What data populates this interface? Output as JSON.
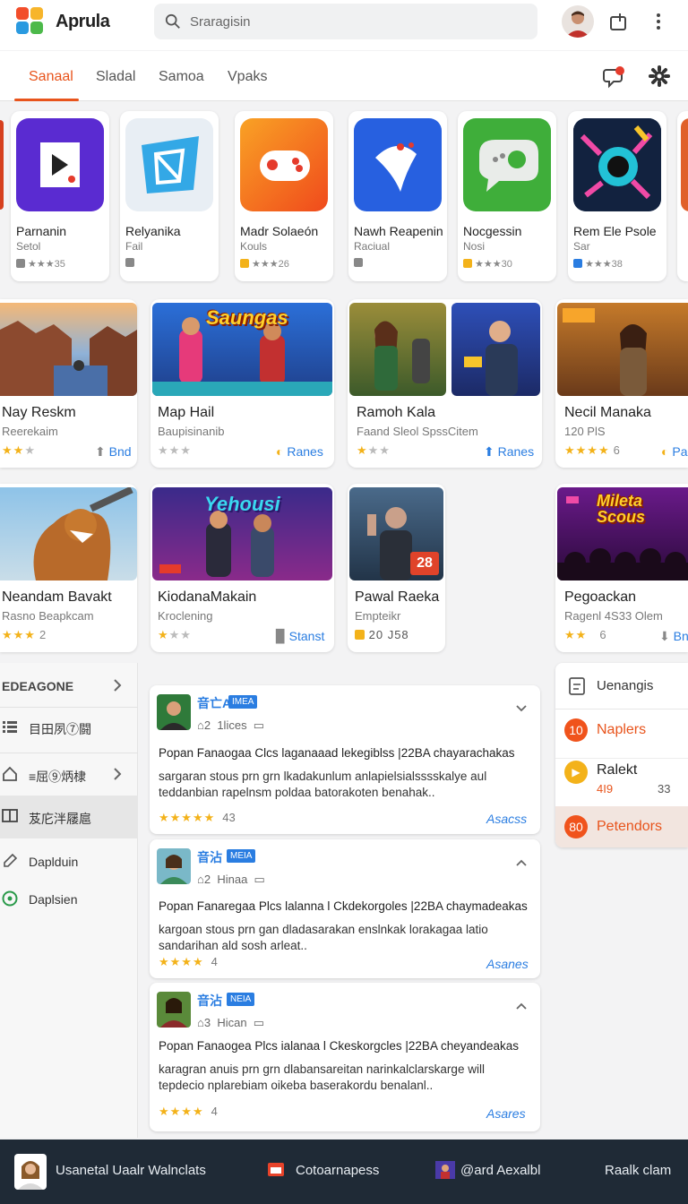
{
  "app": {
    "name": "Aprula"
  },
  "search": {
    "placeholder": "Sraragisin"
  },
  "tabs": [
    "Sanaal",
    "Sladal",
    "Samoa",
    "Vpaks"
  ],
  "apps": [
    {
      "name": "Parnanin",
      "sub": "Setol",
      "rating": "★★★35",
      "icon_color": "#5a2bd1"
    },
    {
      "name": "Relyanika",
      "sub": "Fail",
      "rating": "",
      "icon_color": "#33a8e6"
    },
    {
      "name": "Madr Solaeón",
      "sub": "Kouls",
      "rating": "★★★26",
      "icon_color": "#f26a20"
    },
    {
      "name": "Nawh Reapenin",
      "sub": "Raciual",
      "rating": "",
      "icon_color": "#2760e0"
    },
    {
      "name": "Nocgessin",
      "sub": "Nosi",
      "rating": "★★★30",
      "icon_color": "#3fae3a"
    },
    {
      "name": "Rem Ele Psole",
      "sub": "Sar",
      "rating": "★★★38",
      "icon_color": "#1f3a6b"
    }
  ],
  "games_row1": [
    {
      "title": "Nay Reskm",
      "sub": "Reerekaim",
      "stars": "★★",
      "dim": "★",
      "action": "Bnd"
    },
    {
      "title": "Map Hail",
      "sub": "Baupisinanib",
      "stars": "",
      "dim": "★★★",
      "action": "Ranes",
      "art_text": "Saungas"
    },
    {
      "title": "Ramoh Kala",
      "sub": "Faand Sleol SpssCitem",
      "stars": "★",
      "dim": "★★",
      "action": "Ranes"
    },
    {
      "title": "Necil Manaka",
      "sub": "120 PlS",
      "stars": "★★★★",
      "dim": "",
      "count": "6",
      "action": "Pa"
    }
  ],
  "games_row2": [
    {
      "title": "Neandam Bavakt",
      "sub": "Rasno Beapkcam",
      "stars": "★★★",
      "dim": "",
      "count": "2"
    },
    {
      "title": "KiodanaMakain",
      "sub": "Kroclening",
      "stars": "★",
      "dim": "★★",
      "action": "Stanst",
      "art_text": "Yehousi"
    },
    {
      "title": "Pawal Raeka",
      "sub": "Empteikr",
      "count": "20 J58",
      "badge": "28"
    },
    {
      "title": "Pegoackan",
      "sub": "Ragenl 4S33 Olem",
      "stars": "★★",
      "dim": "",
      "count": "6",
      "action": "Bn",
      "art_text": "Mileta Scous"
    }
  ],
  "sidebar": {
    "items": [
      {
        "label": "EDEAGONE",
        "chevron": true
      },
      {
        "label": "目田夙⑦闘"
      },
      {
        "label": "≡屈⑨炳棣",
        "chevron": true
      },
      {
        "label": "芨庀泮屦扈",
        "active": true
      },
      {
        "label": "Daplduin"
      },
      {
        "label": "Daplsien"
      }
    ]
  },
  "reviews": [
    {
      "name": "音亡A",
      "badge": "IMEA",
      "meta_count": "2",
      "meta_label": "1lices",
      "title": "Popan Fanaogaa Clcs laganaaad lekegiblss |22BA chayarachakas",
      "body": "sargaran stous prn grn lkadakunlum anlapielsialsssskalye aul teddanbian rapelnsm poldaa batorakoten benahak..",
      "stars": "★★★★★",
      "count": "43",
      "link": "Asacss"
    },
    {
      "name": "音沾",
      "badge": "MEIA",
      "meta_count": "2",
      "meta_label": "Hinaa",
      "title": "Popan Fanaregaa Plcs lalanna l Ckdekorgoles |22BA chaymadeakas",
      "body": "kargoan stous prn gan dladasarakan enslnkak lorakagaa latio sandarihan ald sosh arleat..",
      "stars": "★★★★",
      "count": "4",
      "link": "Asanes"
    },
    {
      "name": "音沾",
      "badge": "NEIA",
      "meta_count": "3",
      "meta_label": "Hican",
      "title": "Popan Fanaogea Plcs ialanaa l Ckeskorgcles |22BA cheyandeakas",
      "body": "karagran anuis prn grn dlabansareitan narinkalclarskarge will tepdecio nplarebiam oikeba baserakordu benalanl..",
      "stars": "★★★★",
      "count": "4",
      "link": "Asares"
    }
  ],
  "right_panel": {
    "header": "Uenangis",
    "items": [
      {
        "num": "10",
        "label": "Naplers",
        "color": "#f0531c"
      },
      {
        "num": "▶",
        "label": "Ralekt",
        "color": "#f3b21a",
        "sub1": "4I9",
        "sub2": "33"
      },
      {
        "num": "80",
        "label": "Petendors",
        "color": "#f0531c"
      }
    ]
  },
  "bottom_bar": [
    "Usanetal Uaalr Walnclats",
    "Cotoarnapess",
    "@ard Aexalbl",
    "Raalk clam"
  ]
}
